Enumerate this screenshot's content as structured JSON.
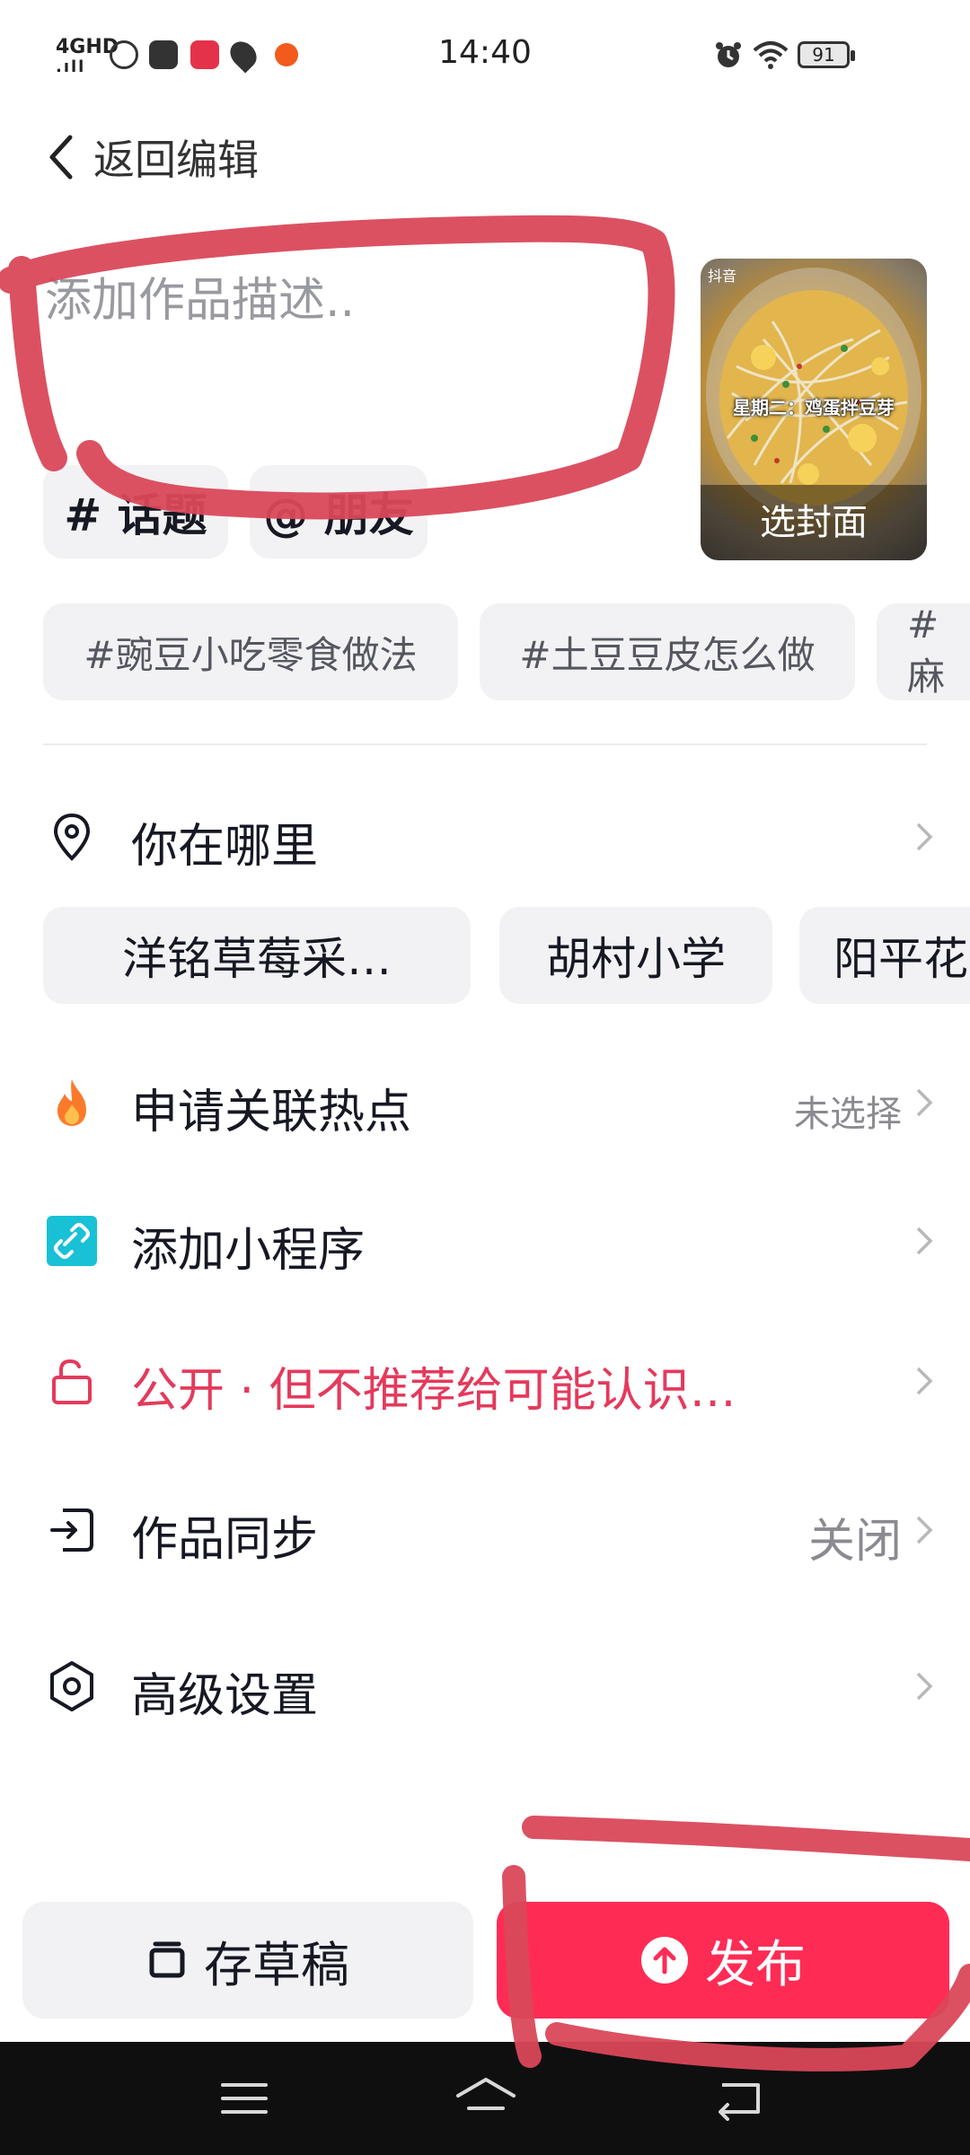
{
  "status_bar": {
    "network": "4GHD",
    "time": "14:40",
    "battery": "91"
  },
  "header": {
    "back_label": "返回编辑"
  },
  "description": {
    "placeholder": "添加作品描述.."
  },
  "cover": {
    "logo": "抖音",
    "overlay_title": "星期二：鸡蛋拌豆芽",
    "select_label": "选封面"
  },
  "mention_chips": [
    {
      "label": "# 话题"
    },
    {
      "label": "@ 朋友"
    }
  ],
  "suggested_tags": [
    "#豌豆小吃零食做法",
    "#土豆豆皮怎么做",
    "#麻"
  ],
  "location": {
    "label": "你在哪里",
    "suggestions": [
      "洋铭草莓采…",
      "胡村小学",
      "阳平花"
    ]
  },
  "rows": {
    "hotspot": {
      "label": "申请关联热点",
      "value": "未选择"
    },
    "mini_program": {
      "label": "添加小程序"
    },
    "privacy": {
      "label": "公开 · 但不推荐给可能认识…"
    },
    "sync": {
      "label": "作品同步",
      "value": "关闭"
    },
    "advanced": {
      "label": "高级设置"
    }
  },
  "buttons": {
    "draft": "存草稿",
    "publish": "发布"
  },
  "colors": {
    "accent": "#fe2c55",
    "privacy_red": "#e43a5c",
    "annotation": "#d9485a"
  },
  "icons": [
    "back-icon",
    "location-pin-icon",
    "fire-icon",
    "mini-program-icon",
    "lock-open-icon",
    "sync-icon",
    "settings-hex-icon",
    "draft-icon",
    "upload-arrow-icon",
    "chevron-right-icon"
  ]
}
